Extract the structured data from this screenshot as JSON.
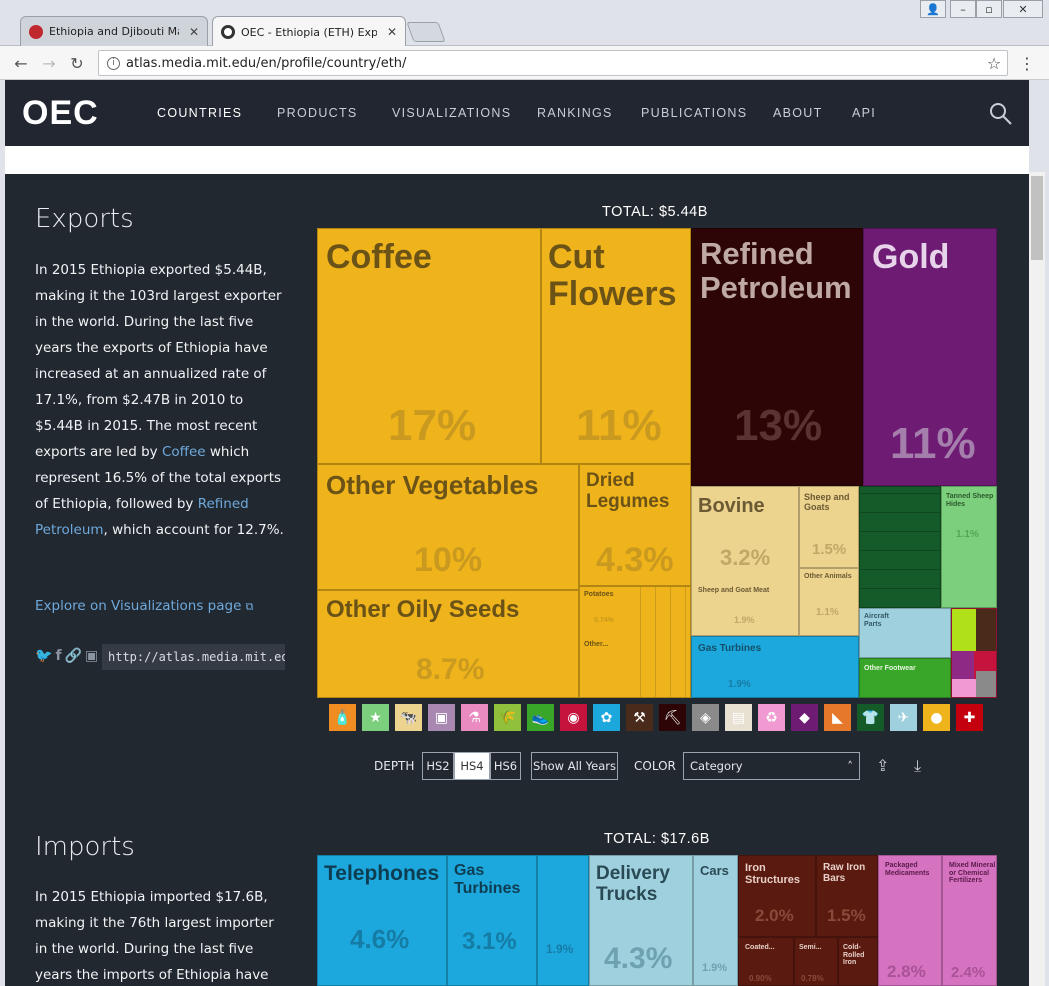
{
  "browser": {
    "tabs": [
      {
        "label": "Ethiopia and Djibouti March"
      },
      {
        "label": "OEC - Ethiopia (ETH) Export"
      }
    ],
    "url": "atlas.media.mit.edu/en/profile/country/eth/",
    "icons": [
      "back-icon",
      "forward-icon",
      "reload-icon",
      "info-icon",
      "star-icon",
      "menu-icon"
    ]
  },
  "nav": {
    "logo": "OEC",
    "items": [
      "COUNTRIES",
      "PRODUCTS",
      "VISUALIZATIONS",
      "RANKINGS",
      "PUBLICATIONS",
      "ABOUT",
      "API"
    ]
  },
  "exports": {
    "title": "Exports",
    "p1": "In 2015 Ethiopia exported $5.44B, making it the 103rd largest exporter in the world. During the last five years the exports of Ethiopia have increased at an annualized rate of 17.1%, from $2.47B in 2010 to $5.44B in 2015. The most recent exports are led by ",
    "link1": "Coffee",
    "p2": " which represent 16.5% of the total exports of Ethiopia, followed by ",
    "link2": "Refined Petroleum",
    "p3": ", which account for 12.7%.",
    "explore": "Explore on Visualizations page",
    "permalink": "http://atlas.media.mit.edu/en/",
    "total": "TOTAL: $5.44B",
    "tiles": [
      {
        "label": "Coffee",
        "pct": "17%",
        "color": "#efb31b"
      },
      {
        "label": "Cut Flowers",
        "pct": "11%",
        "color": "#efb31b"
      },
      {
        "label": "Refined Petroleum",
        "pct": "13%",
        "color": "#2e0506"
      },
      {
        "label": "Gold",
        "pct": "11%",
        "color": "#6e1b74"
      },
      {
        "label": "Other Vegetables",
        "pct": "10%",
        "color": "#efb31b"
      },
      {
        "label": "Dried Legumes",
        "pct": "4.3%",
        "color": "#efb31b"
      },
      {
        "label": "Other Oily Seeds",
        "pct": "8.7%",
        "color": "#efb31b"
      },
      {
        "label": "Bovine",
        "pct": "3.2%",
        "color": "#ecd38e"
      },
      {
        "label": "Sheep and Goats",
        "pct": "1.5%",
        "color": "#ecd38e"
      },
      {
        "label": "Sheep and Goat Meat",
        "pct": "1.9%",
        "color": "#ecd38e"
      },
      {
        "label": "Other Animals",
        "pct": "1.1%",
        "color": "#ecd38e"
      },
      {
        "label": "Tanned Sheep Hides",
        "pct": "1.1%",
        "color": "#7ccf7c"
      },
      {
        "label": "Gas Turbines",
        "pct": "1.9%",
        "color": "#1da8dd"
      },
      {
        "label": "Aircraft Parts",
        "pct": "",
        "color": "#9fd0dd"
      },
      {
        "label": "Other Footwear",
        "pct": "",
        "color": "#3aa629"
      },
      {
        "label": "Potatoes",
        "pct": "0.74%",
        "color": "#efb31b"
      },
      {
        "label": "Other...",
        "pct": "",
        "color": "#efb31b"
      }
    ],
    "categories": [
      "#ef8d22",
      "#7ccf7c",
      "#ecd38e",
      "#a888b0",
      "#e98bc0",
      "#91c13c",
      "#3aa629",
      "#c4143e",
      "#1da8dd",
      "#4a2a1a",
      "#2e0506",
      "#8a8a8a",
      "#e8e0d0",
      "#f19ad1",
      "#6e1b74",
      "#e6782b",
      "#155a29",
      "#9fd0dd",
      "#efb31b",
      "#c4000f"
    ],
    "depth_label": "DEPTH",
    "depth": [
      "HS2",
      "HS4",
      "HS6"
    ],
    "show_years": "Show All Years",
    "color_label": "COLOR",
    "color_select": "Category"
  },
  "imports": {
    "title": "Imports",
    "p1": "In 2015 Ethiopia imported $17.6B, making it the 76th largest importer in the world. During the last five years the imports of Ethiopia have",
    "total": "TOTAL: $17.6B",
    "tiles": [
      {
        "label": "Telephones",
        "pct": "4.6%"
      },
      {
        "label": "Gas Turbines",
        "pct": "3.1%"
      },
      {
        "label": "",
        "pct": "1.9%"
      },
      {
        "label": "Delivery Trucks",
        "pct": "4.3%"
      },
      {
        "label": "Cars",
        "pct": "1.9%"
      },
      {
        "label": "Iron Structures",
        "pct": "2.0%"
      },
      {
        "label": "Raw Iron Bars",
        "pct": "1.5%"
      },
      {
        "label": "Packaged Medicaments",
        "pct": "2.8%"
      },
      {
        "label": "Mixed Mineral or Chemical Fertilizers",
        "pct": "2.4%"
      },
      {
        "label": "Coated...",
        "pct": "0.90%"
      },
      {
        "label": "Semi...",
        "pct": "0.78%"
      },
      {
        "label": "Cold-Rolled Iron",
        "pct": ""
      }
    ]
  }
}
